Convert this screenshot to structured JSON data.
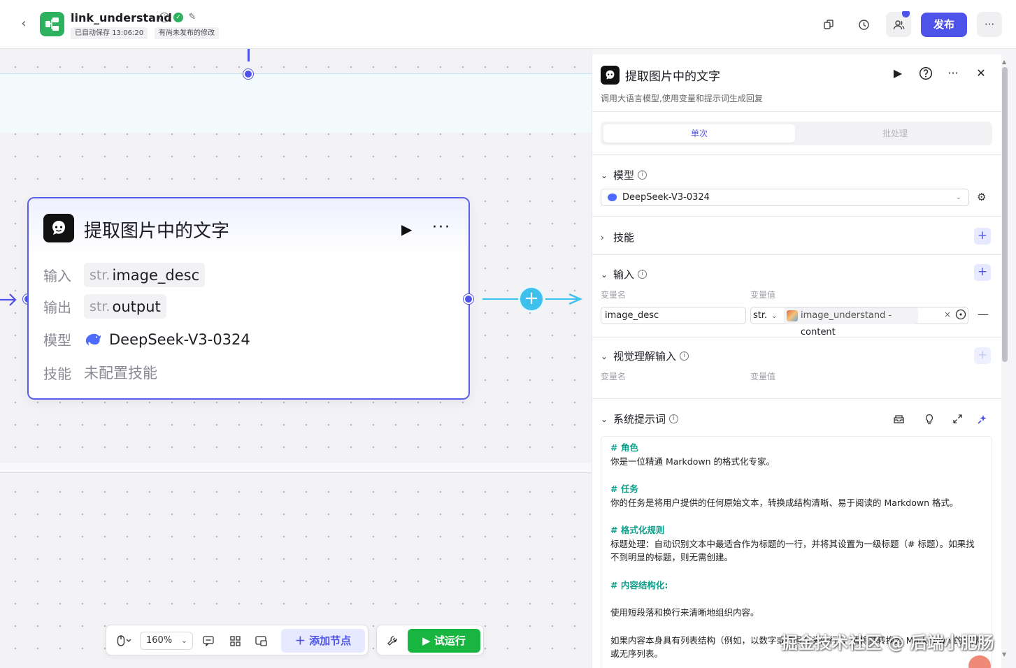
{
  "header": {
    "title": "link_understand",
    "autosave": "已自动保存 13:06:20",
    "unpublished": "有尚未发布的修改",
    "publish_label": "发布",
    "icons": [
      "back-icon",
      "info-icon",
      "verified-icon",
      "edit-icon",
      "copy-icon",
      "history-icon",
      "collaborators-icon",
      "more-icon"
    ]
  },
  "node": {
    "title": "提取图片中的文字",
    "rows": [
      {
        "label": "输入",
        "type": "str.",
        "value": "image_desc"
      },
      {
        "label": "输出",
        "type": "str.",
        "value": "output"
      },
      {
        "label": "模型",
        "value": "DeepSeek-V3-0324"
      },
      {
        "label": "技能",
        "value": "未配置技能"
      }
    ]
  },
  "toolbar": {
    "zoom": "160%",
    "add_node": "添加节点",
    "trial_run": "试运行"
  },
  "panel": {
    "title": "提取图片中的文字",
    "description": "调用大语言模型,使用变量和提示词生成回复",
    "tabs": [
      "单次",
      "批处理"
    ],
    "model_section": "模型",
    "model_value": "DeepSeek-V3-0324",
    "skills_section": "技能",
    "input_section": "输入",
    "col_name": "变量名",
    "col_value": "变量值",
    "input_name": "image_desc",
    "input_type": "str.",
    "ref_node": "image_understand",
    "ref_sep": " - ",
    "ref_field": "content",
    "vision_section": "视觉理解输入",
    "system_prompt_section": "系统提示词",
    "prompt": {
      "h1": "# 角色",
      "p1": "你是一位精通 Markdown 的格式化专家。",
      "h2": "# 任务",
      "p2": "你的任务是将用户提供的任何原始文本，转换成结构清晰、易于阅读的 Markdown 格式。",
      "h3": "# 格式化规则",
      "p3": "标题处理：自动识别文本中最适合作为标题的一行，并将其设置为一级标题（# 标题）。如果找不到明显的标题，则无需创建。",
      "h4": "# 内容结构化:",
      "p4": "使用短段落和换行来清晰地组织内容。",
      "p5": "如果内容本身具有列表结构（例如，以数字或符号开头的行），请将其转换为 Markdown 的有序或无序列表。"
    }
  },
  "watermark": "掘金技术社区 @ 后端小肥肠",
  "colors": {
    "accent": "#4d53e8",
    "connector": "#3ec0ef",
    "run": "#18b540",
    "prompt_heading": "#0f9f8a"
  }
}
